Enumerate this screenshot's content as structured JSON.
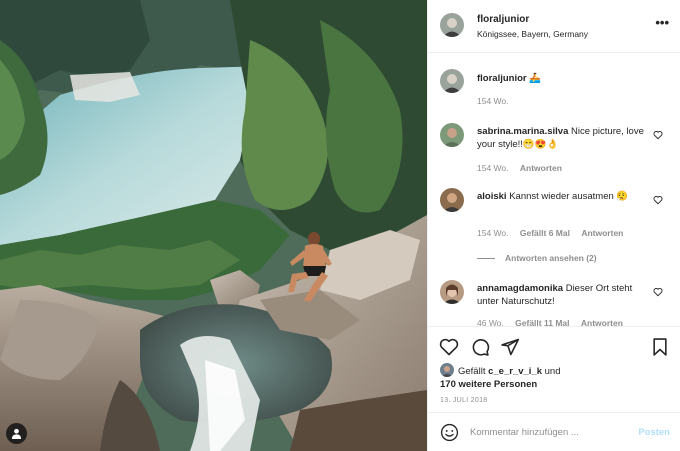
{
  "post": {
    "photo": {
      "alt_icon": "person-tag-icon"
    },
    "header": {
      "username": "floraljunior",
      "location": "Königssee, Bayern, Germany",
      "more_label": "•••"
    },
    "caption": {
      "username": "floraljunior",
      "text": "🚣",
      "age": "154 Wo."
    },
    "comments": [
      {
        "username": "sabrina.marina.silva",
        "text": "Nice picture, love your style!!😁😍👌",
        "age": "154 Wo.",
        "likes": "",
        "reply": "Antworten"
      },
      {
        "username": "aloiski",
        "text": "Kannst wieder ausatmen 😮‍💨",
        "age": "154 Wo.",
        "likes": "Gefällt 6 Mal",
        "reply": "Antworten"
      },
      {
        "username": "annamagdamonika",
        "text": "Dieser Ort steht unter Naturschutz!",
        "age": "46 Wo.",
        "likes": "Gefällt 11 Mal",
        "reply": "Antworten"
      }
    ],
    "view_replies": "Antworten ansehen (2)",
    "likes": {
      "prefix": "Gefällt",
      "liker": "c_e_r_v_i_k",
      "conjunction": "und",
      "others": "170 weitere Personen"
    },
    "date": "13. JULI 2018",
    "composer": {
      "placeholder": "Kommentar hinzufügen ...",
      "post_label": "Posten"
    },
    "colors": {
      "link_blue_disabled": "#b2dffc",
      "secondary_text": "#8e8e8e",
      "border": "#efefef"
    }
  }
}
